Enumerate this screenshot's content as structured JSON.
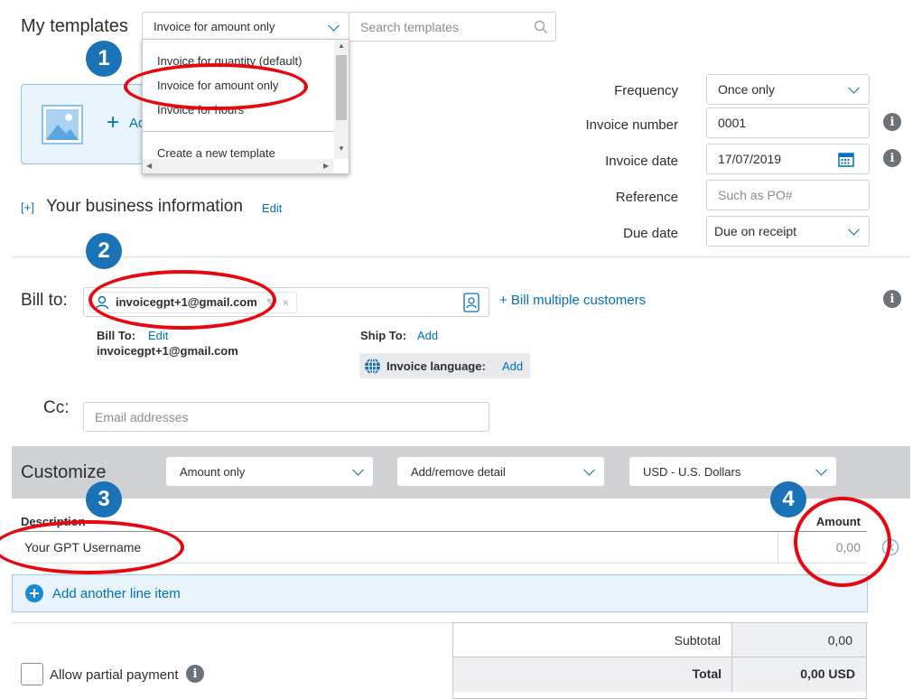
{
  "header": {
    "title": "My templates",
    "template_select": "Invoice for amount only",
    "search_placeholder": "Search templates"
  },
  "template_dropdown": {
    "items": [
      "Invoice for quantity (default)",
      "Invoice for amount only",
      "Invoice for hours"
    ],
    "create_label": "Create a new template"
  },
  "logo": {
    "add_label": "Ad"
  },
  "invoice_meta": {
    "frequency_label": "Frequency",
    "frequency_value": "Once only",
    "number_label": "Invoice number",
    "number_value": "0001",
    "date_label": "Invoice date",
    "date_value": "17/07/2019",
    "reference_label": "Reference",
    "reference_placeholder": "Such as PO#",
    "due_label": "Due date",
    "due_value": "Due on receipt"
  },
  "business": {
    "toggle": "[+]",
    "title": "Your business information",
    "edit": "Edit"
  },
  "bill": {
    "label": "Bill to:",
    "recipient": "invoicegpt+1@gmail.com",
    "multiple_link": "+ Bill multiple customers",
    "bill_to_label": "Bill To:",
    "bill_to_edit": "Edit",
    "bill_to_email": "invoicegpt+1@gmail.com",
    "ship_to_label": "Ship To:",
    "ship_to_add": "Add",
    "language_label": "Invoice language:",
    "language_add": "Add"
  },
  "cc": {
    "label": "Cc:",
    "placeholder": "Email addresses"
  },
  "customize": {
    "title": "Customize",
    "mode_select": "Amount only",
    "detail_select": "Add/remove detail",
    "currency_select": "USD - U.S. Dollars"
  },
  "items": {
    "desc_header": "Description",
    "amount_header": "Amount",
    "row_desc": "Your GPT Username",
    "row_amount": "0,00",
    "add_line": "Add another line item"
  },
  "totals": {
    "partial_label": "Allow partial payment",
    "subtotal_label": "Subtotal",
    "subtotal_value": "0,00",
    "total_label": "Total",
    "total_value": "0,00 USD"
  },
  "annotations": [
    "1",
    "2",
    "3",
    "4"
  ],
  "colors": {
    "accent": "#0070ba",
    "badge": "#1a73b6",
    "highlight": "#e6080e",
    "customize_bar": "#cfd1d3"
  }
}
